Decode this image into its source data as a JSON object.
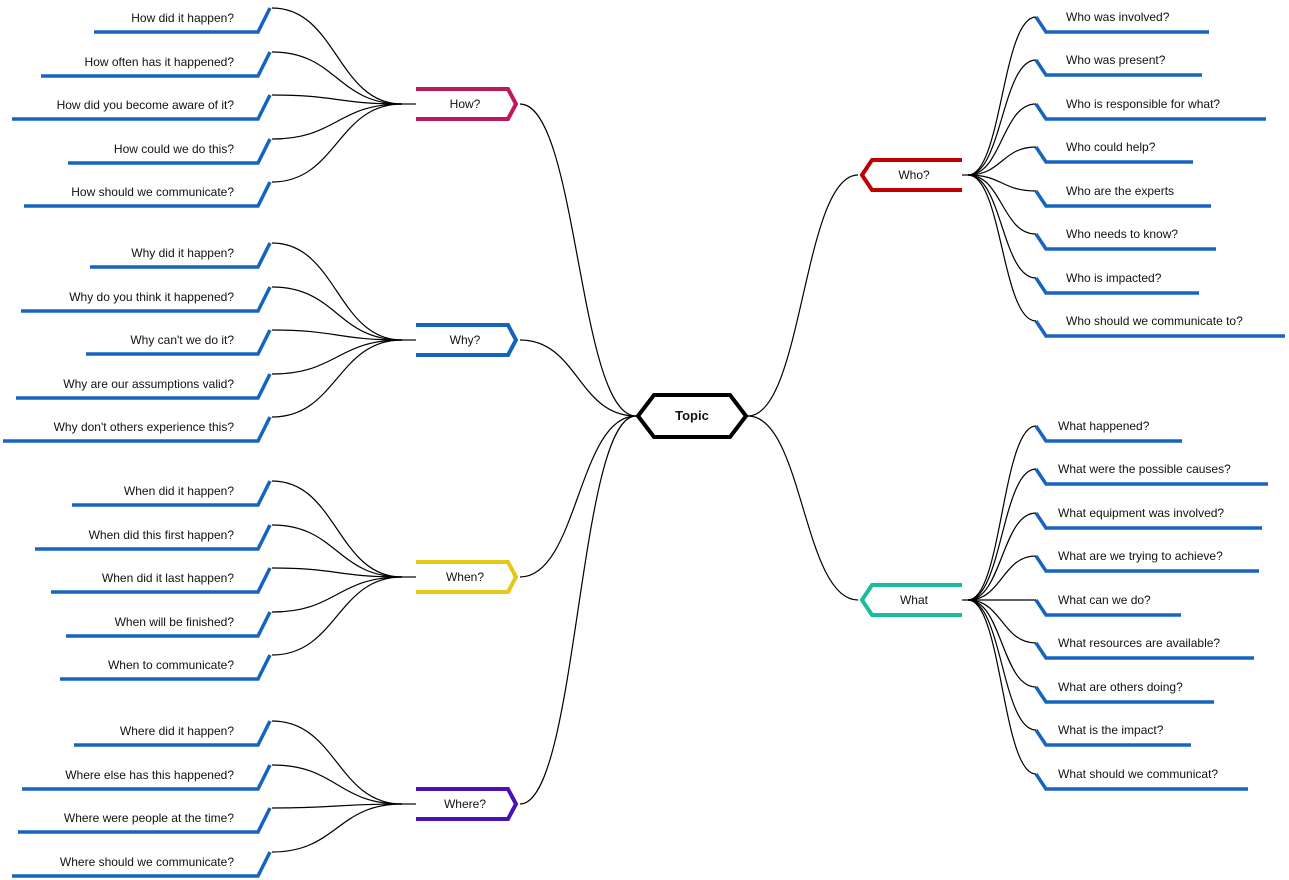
{
  "topic": {
    "label": "Topic",
    "color": "#000000"
  },
  "leaf_color": "#1565c0",
  "branches": [
    {
      "id": "how",
      "label": "How?",
      "side": "left",
      "color": "#c2185b",
      "items": [
        "How did it happen?",
        "How often has it happened?",
        "How did you become aware of it?",
        "How could we do this?",
        "How should we communicate?"
      ]
    },
    {
      "id": "why",
      "label": "Why?",
      "side": "left",
      "color": "#1565c0",
      "items": [
        "Why did it happen?",
        "Why do you think it happened?",
        "Why can't we do it?",
        "Why are our assumptions valid?",
        "Why don't others experience this?"
      ]
    },
    {
      "id": "when",
      "label": "When?",
      "side": "left",
      "color": "#e6c619",
      "items": [
        "When did it happen?",
        "When did this first happen?",
        "When did it last happen?",
        "When will be finished?",
        "When to communicate?"
      ]
    },
    {
      "id": "where",
      "label": "Where?",
      "side": "left",
      "color": "#4a12b5",
      "items": [
        "Where did it happen?",
        "Where else has this happened?",
        "Where were people at the time?",
        "Where should we communicate?"
      ]
    },
    {
      "id": "who",
      "label": "Who?",
      "side": "right",
      "color": "#c00000",
      "items": [
        "Who was involved?",
        "Who was present?",
        "Who is responsible for what?",
        "Who could help?",
        "Who are the experts",
        "Who needs to know?",
        "Who is impacted?",
        "Who should we communicate to?"
      ]
    },
    {
      "id": "what",
      "label": "What",
      "side": "right",
      "color": "#1abc9c",
      "items": [
        "What happened?",
        "What were the possible causes?",
        "What equipment was involved?",
        "What are we trying to achieve?",
        "What can we do?",
        "What resources are available?",
        "What are others doing?",
        "What is the impact?",
        "What should we communicat?"
      ]
    }
  ]
}
